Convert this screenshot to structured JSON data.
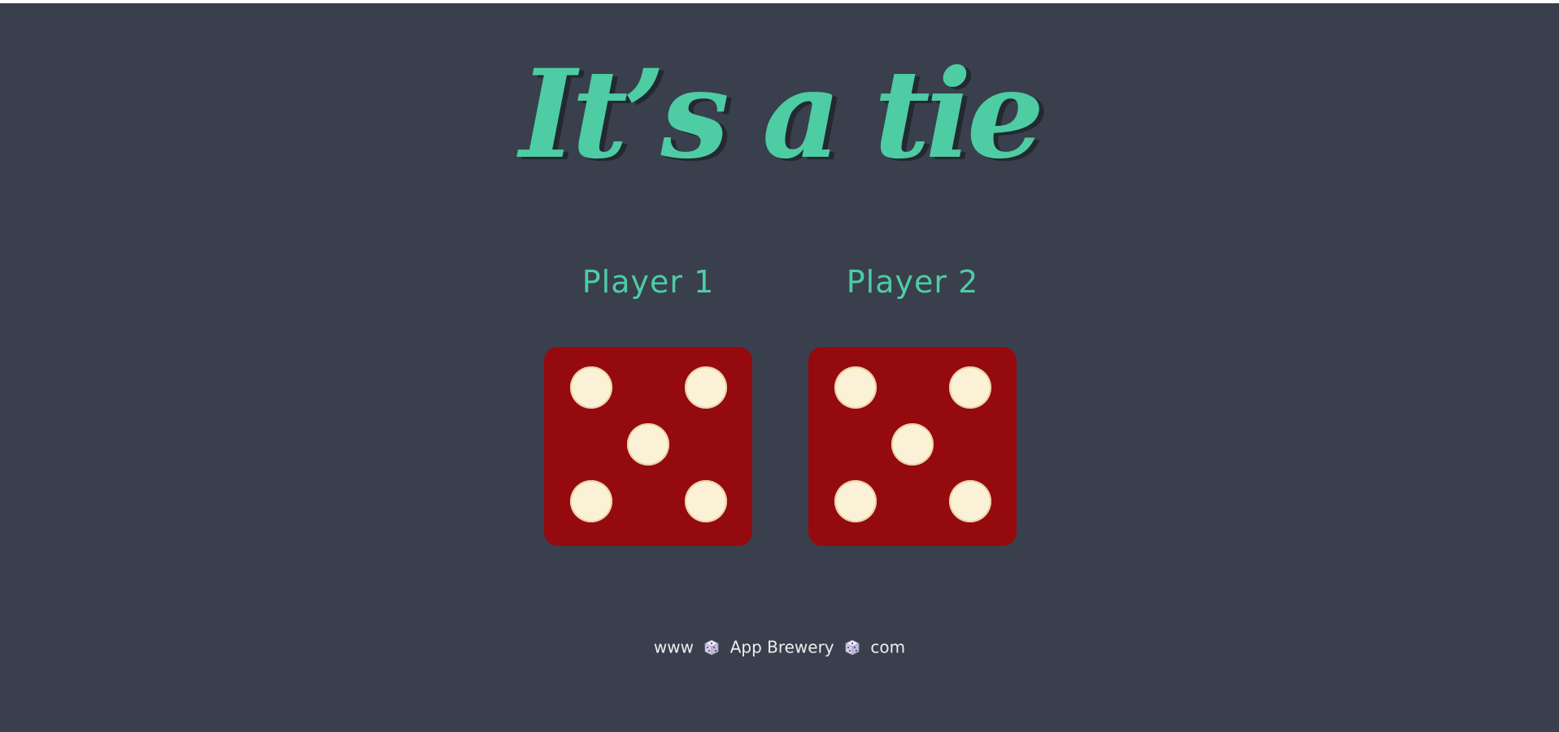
{
  "title": "It’s a tie",
  "players": [
    {
      "label": "Player 1",
      "die_value": 5
    },
    {
      "label": "Player 2",
      "die_value": 5
    }
  ],
  "footer": {
    "prefix": "www",
    "brand": "App Brewery",
    "suffix": "com",
    "separator_icon": "die-icon"
  },
  "colors": {
    "background": "#393f4d",
    "accent": "#4ecca3",
    "die_face": "#950a0e",
    "pip": "#fbf1d6",
    "footer_text": "#eeeeee"
  }
}
